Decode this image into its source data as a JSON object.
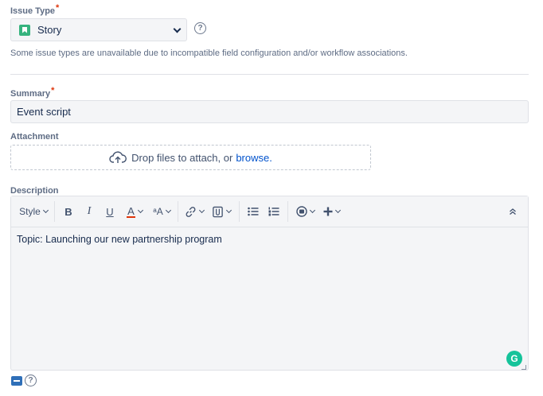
{
  "issue_type": {
    "label": "Issue Type",
    "required_mark": "*",
    "selected": "Story",
    "help": "?",
    "note": "Some issue types are unavailable due to incompatible field configuration and/or workflow associations."
  },
  "summary": {
    "label": "Summary",
    "required_mark": "*",
    "value": "Event script"
  },
  "attachment": {
    "label": "Attachment",
    "drop_text": "Drop files to attach, or",
    "browse_link": "browse."
  },
  "description": {
    "label": "Description",
    "toolbar": {
      "style": "Style",
      "bold": "B",
      "italic": "I",
      "underline": "U",
      "text_color": "A",
      "more_format": "ᵃA"
    },
    "content": "Topic: Launching our new partnership program",
    "grammarly_badge": "G",
    "help": "?"
  },
  "colors": {
    "story_green": "#36b37e",
    "link_blue": "#0052cc",
    "required_red": "#de350b",
    "text_color_underline": "#de350b"
  }
}
